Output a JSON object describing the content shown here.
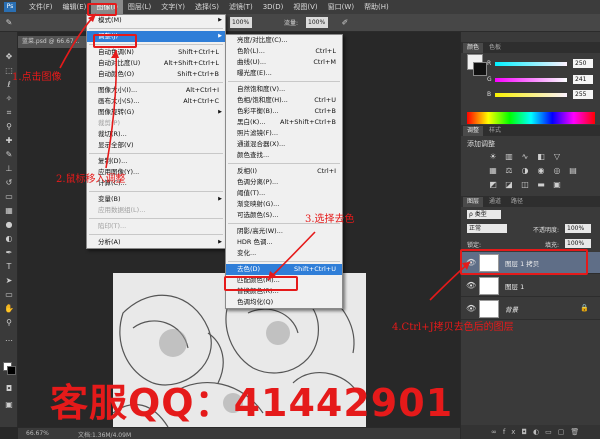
{
  "menubar": {
    "logo": "Ps",
    "items": [
      "文件(F)",
      "编辑(E)",
      "图像(I)",
      "图层(L)",
      "文字(Y)",
      "选择(S)",
      "滤镜(T)",
      "3D(D)",
      "视图(V)",
      "窗口(W)",
      "帮助(H)"
    ],
    "active_index": 2
  },
  "options": {
    "zoom": "100%",
    "flow_label": "流量:",
    "flow_value": "100%"
  },
  "document": {
    "tab_title": "蓝菜.psd @ 66.67..."
  },
  "status": {
    "zoom": "66.67%",
    "doc_info": "文档:1.36M/4.09M"
  },
  "image_menu": {
    "items": [
      {
        "label": "模式(M)",
        "submenu": true
      },
      {
        "sep": true
      },
      {
        "label": "调整(J)",
        "submenu": true,
        "highlight": true
      },
      {
        "sep": true
      },
      {
        "label": "自动色调(N)",
        "shortcut": "Shift+Ctrl+L"
      },
      {
        "label": "自动对比度(U)",
        "shortcut": "Alt+Shift+Ctrl+L"
      },
      {
        "label": "自动颜色(O)",
        "shortcut": "Shift+Ctrl+B"
      },
      {
        "sep": true
      },
      {
        "label": "图像大小(I)...",
        "shortcut": "Alt+Ctrl+I"
      },
      {
        "label": "画布大小(S)...",
        "shortcut": "Alt+Ctrl+C"
      },
      {
        "label": "图像旋转(G)",
        "submenu": true
      },
      {
        "label": "裁剪(P)",
        "disabled": true
      },
      {
        "label": "裁切(R)..."
      },
      {
        "label": "显示全部(V)"
      },
      {
        "sep": true
      },
      {
        "label": "复制(D)..."
      },
      {
        "label": "应用图像(Y)..."
      },
      {
        "label": "计算(C)..."
      },
      {
        "sep": true
      },
      {
        "label": "变量(B)",
        "submenu": true
      },
      {
        "label": "应用数据组(L)...",
        "disabled": true
      },
      {
        "sep": true
      },
      {
        "label": "陷印(T)...",
        "disabled": true
      },
      {
        "sep": true
      },
      {
        "label": "分析(A)",
        "submenu": true
      }
    ]
  },
  "adjust_menu": {
    "items": [
      {
        "label": "亮度/对比度(C)..."
      },
      {
        "label": "色阶(L)...",
        "shortcut": "Ctrl+L"
      },
      {
        "label": "曲线(U)...",
        "shortcut": "Ctrl+M"
      },
      {
        "label": "曝光度(E)..."
      },
      {
        "sep": true
      },
      {
        "label": "自然饱和度(V)..."
      },
      {
        "label": "色相/饱和度(H)...",
        "shortcut": "Ctrl+U"
      },
      {
        "label": "色彩平衡(B)...",
        "shortcut": "Ctrl+B"
      },
      {
        "label": "黑白(K)...",
        "shortcut": "Alt+Shift+Ctrl+B"
      },
      {
        "label": "照片滤镜(F)..."
      },
      {
        "label": "通道混合器(X)..."
      },
      {
        "label": "颜色查找..."
      },
      {
        "sep": true
      },
      {
        "label": "反相(I)",
        "shortcut": "Ctrl+I"
      },
      {
        "label": "色调分离(P)..."
      },
      {
        "label": "阈值(T)..."
      },
      {
        "label": "渐变映射(G)..."
      },
      {
        "label": "可选颜色(S)..."
      },
      {
        "sep": true
      },
      {
        "label": "阴影/高光(W)..."
      },
      {
        "label": "HDR 色调..."
      },
      {
        "label": "变化..."
      },
      {
        "sep": true
      },
      {
        "label": "去色(D)",
        "shortcut": "Shift+Ctrl+U",
        "highlight": true
      },
      {
        "label": "匹配颜色(M)..."
      },
      {
        "label": "替换颜色(R)..."
      },
      {
        "label": "色调均化(Q)"
      }
    ]
  },
  "color_panel": {
    "tabs": [
      "颜色",
      "色板"
    ],
    "r": "250",
    "g": "241",
    "b": "255",
    "r_label": "R",
    "g_label": "G",
    "b_label": "B"
  },
  "adjust_panel": {
    "tabs": [
      "调整",
      "样式"
    ],
    "title": "添加调整"
  },
  "layers_panel": {
    "tabs": [
      "图层",
      "通道",
      "路径"
    ],
    "filter_label": "ρ 类型",
    "blend_mode": "正常",
    "opacity_label": "不透明度:",
    "opacity_value": "100%",
    "lock_label": "锁定:",
    "fill_label": "填充:",
    "fill_value": "100%",
    "layers": [
      {
        "name": "图层 1 拷贝",
        "selected": true
      },
      {
        "name": "图层 1",
        "selected": false
      },
      {
        "name": "背景",
        "selected": false,
        "locked": true
      }
    ]
  },
  "annotations": {
    "step1": "1.点击图像",
    "step2": "2.鼠标移入调整",
    "step3": "3.选择去色",
    "step4": "4.Ctrl+J拷贝去色后的图层",
    "contact": "客服QQ：41442901"
  },
  "colors": {
    "annotation_red": "#e51a1a",
    "menu_highlight": "#2f7ed8",
    "selected_layer": "#5f6e87"
  }
}
